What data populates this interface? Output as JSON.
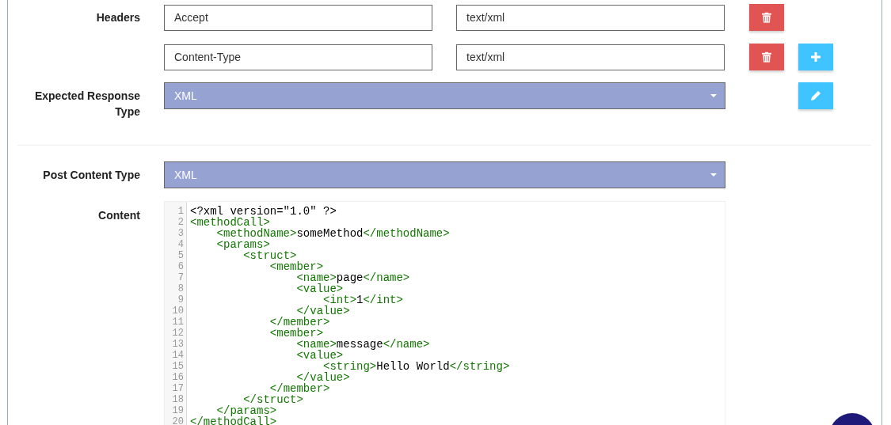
{
  "headers": {
    "label": "Headers",
    "rows": [
      {
        "name": "Accept",
        "value": "text/xml",
        "add_button": false
      },
      {
        "name": "Content-Type",
        "value": "text/xml",
        "add_button": true
      }
    ]
  },
  "expected_response_type": {
    "label": "Expected Response Type",
    "value": "XML"
  },
  "post_content_type": {
    "label": "Post Content Type",
    "value": "XML"
  },
  "content": {
    "label": "Content",
    "lines": [
      {
        "number": "1",
        "text": "<?xml version=\"1.0\" ?>"
      },
      {
        "number": "2",
        "text": "<methodCall>"
      },
      {
        "number": "3",
        "text": "    <methodName>someMethod</methodName>"
      },
      {
        "number": "4",
        "text": "    <params>"
      },
      {
        "number": "5",
        "text": "        <struct>"
      },
      {
        "number": "6",
        "text": "            <member>"
      },
      {
        "number": "7",
        "text": "                <name>page</name>"
      },
      {
        "number": "8",
        "text": "                <value>"
      },
      {
        "number": "9",
        "text": "                    <int>1</int>"
      },
      {
        "number": "10",
        "text": "                </value>"
      },
      {
        "number": "11",
        "text": "            </member>"
      },
      {
        "number": "12",
        "text": "            <member>"
      },
      {
        "number": "13",
        "text": "                <name>message</name>"
      },
      {
        "number": "14",
        "text": "                <value>"
      },
      {
        "number": "15",
        "text": "                    <string>Hello World</string>"
      },
      {
        "number": "16",
        "text": "                </value>"
      },
      {
        "number": "17",
        "text": "            </member>"
      },
      {
        "number": "18",
        "text": "        </struct>"
      },
      {
        "number": "19",
        "text": "    </params>"
      },
      {
        "number": "20",
        "text": "</methodCall>"
      }
    ]
  }
}
